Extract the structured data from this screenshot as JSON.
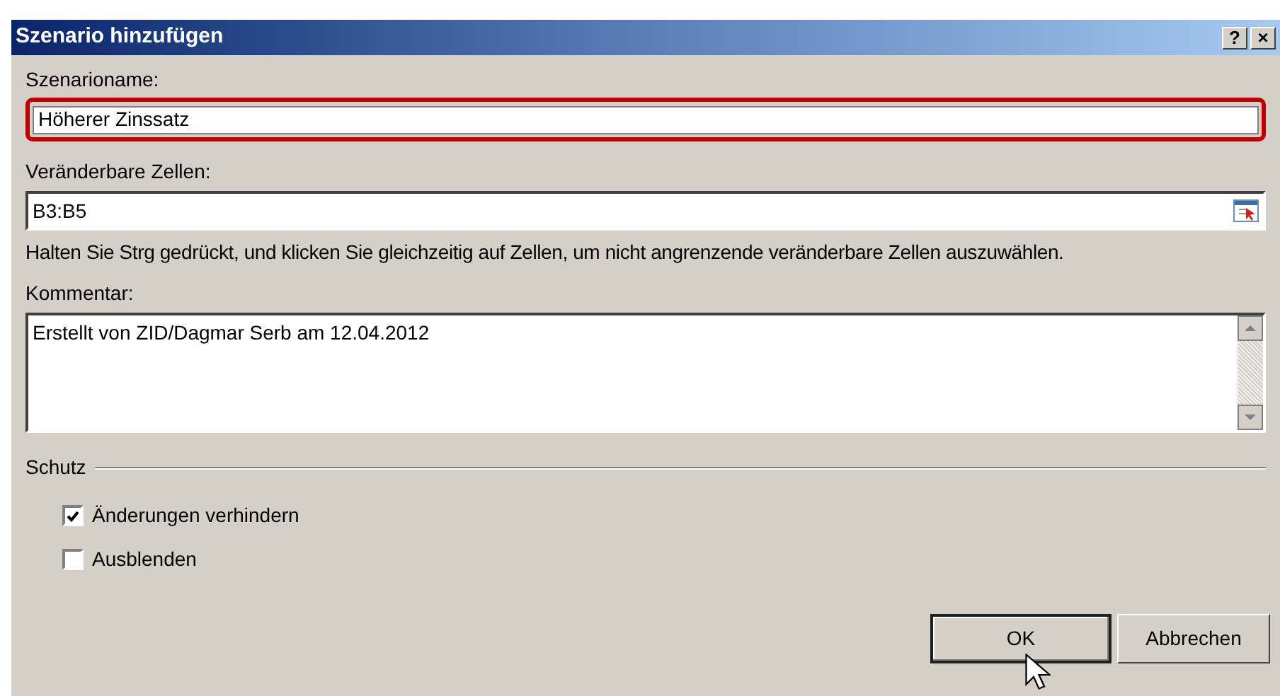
{
  "window": {
    "title": "Szenario hinzufügen",
    "title_buttons": [
      "?",
      "×"
    ]
  },
  "scenario_name": {
    "label": "Szenarioname:",
    "value": "Höherer Zinssatz",
    "highlighted": true
  },
  "changing_cells": {
    "label": "Veränderbare Zellen:",
    "value": "B3:B5"
  },
  "hint": "Halten Sie Strg gedrückt, und klicken Sie gleichzeitig auf Zellen, um nicht angrenzende veränderbare Zellen auszuwählen.",
  "comment": {
    "label": "Kommentar:",
    "value": "Erstellt von ZID/Dagmar Serb am 12.04.2012"
  },
  "protection": {
    "title": "Schutz",
    "options": [
      {
        "label": "Änderungen verhindern",
        "checked": true
      },
      {
        "label": "Ausblenden",
        "checked": false
      }
    ]
  },
  "buttons": [
    {
      "label": "OK",
      "default": true
    },
    {
      "label": "Abbrechen",
      "default": false
    }
  ]
}
